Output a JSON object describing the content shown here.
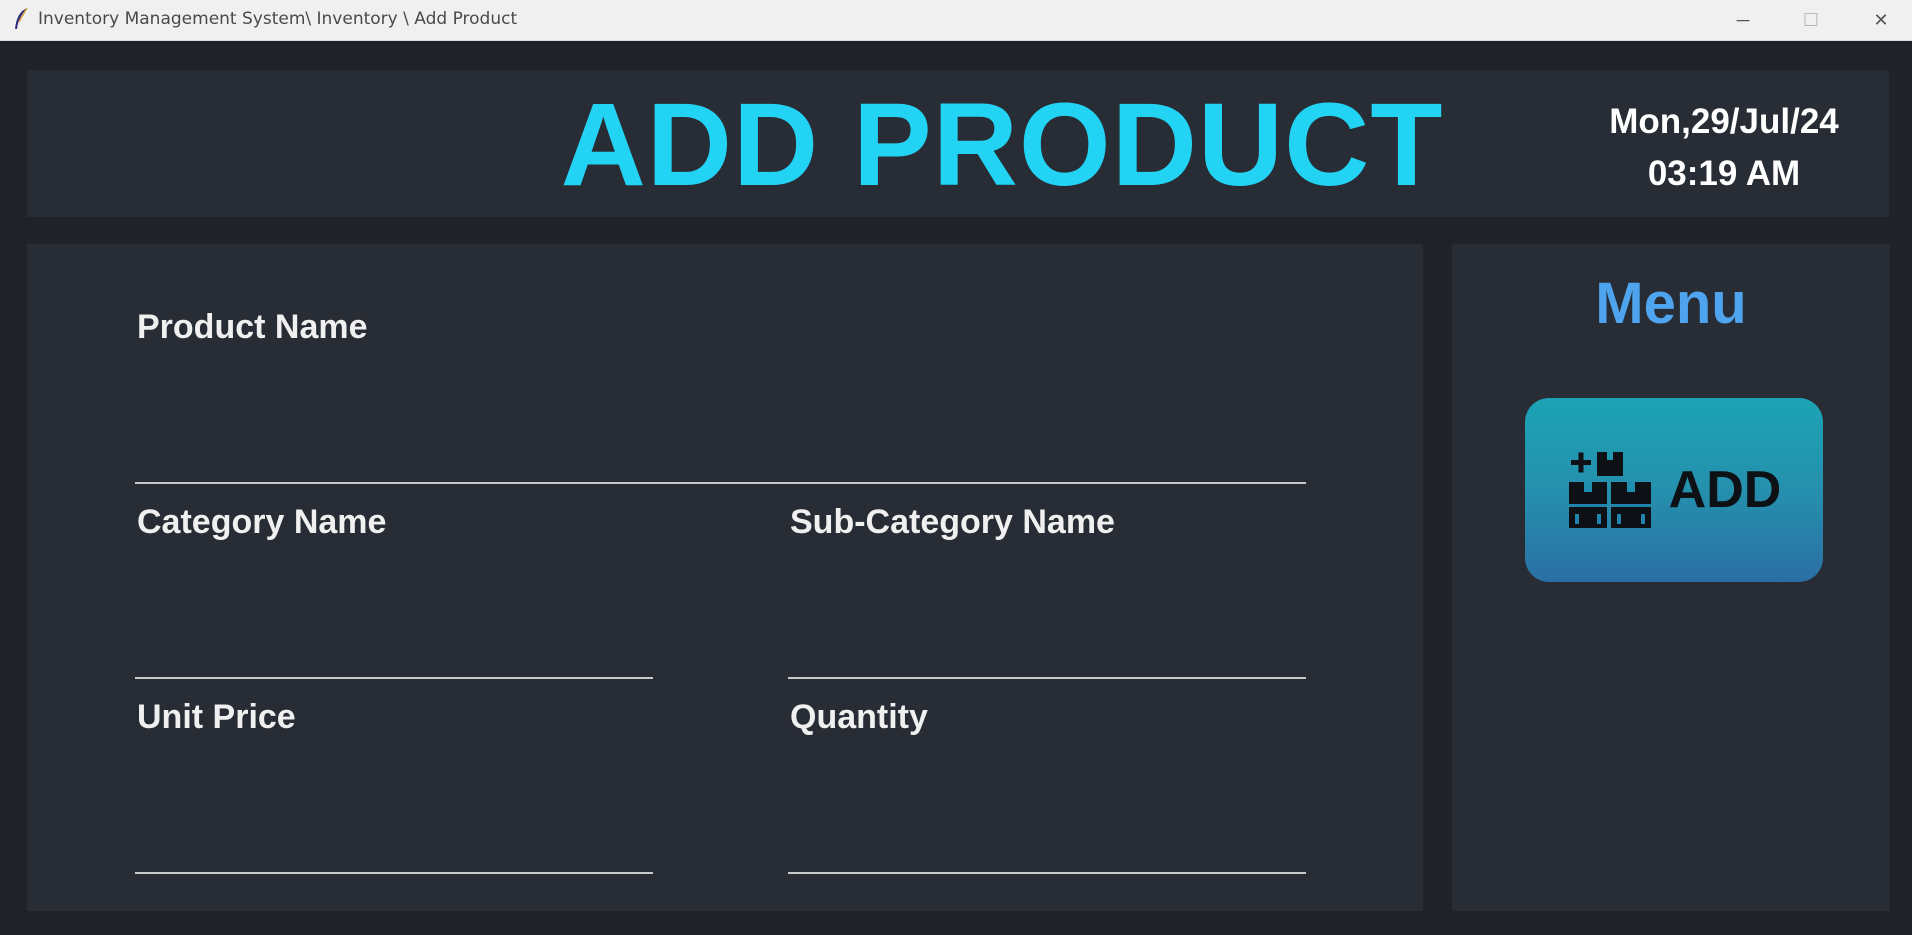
{
  "window": {
    "title": "Inventory Management System\\ Inventory \\ Add Product",
    "app_icon": "feather-icon",
    "controls": {
      "minimize": "─",
      "maximize": "☐",
      "close": "✕"
    }
  },
  "header": {
    "title": "ADD PRODUCT",
    "date": "Mon,29/Jul/24",
    "time": "03:19 AM"
  },
  "form": {
    "product_name": {
      "label": "Product Name",
      "value": ""
    },
    "category_name": {
      "label": "Category Name",
      "value": ""
    },
    "sub_category_name": {
      "label": "Sub-Category Name",
      "value": ""
    },
    "unit_price": {
      "label": "Unit Price",
      "value": ""
    },
    "quantity": {
      "label": "Quantity",
      "value": ""
    }
  },
  "menu": {
    "title": "Menu",
    "add_button": {
      "label": "ADD",
      "icon": "add-boxes-icon"
    }
  },
  "colors": {
    "background": "#1f2329",
    "panel": "#282c34",
    "title_accent": "#22d3f4",
    "menu_accent": "#4ea4ee",
    "button_top": "#1ca3b5",
    "button_bottom": "#2a6fa4"
  }
}
